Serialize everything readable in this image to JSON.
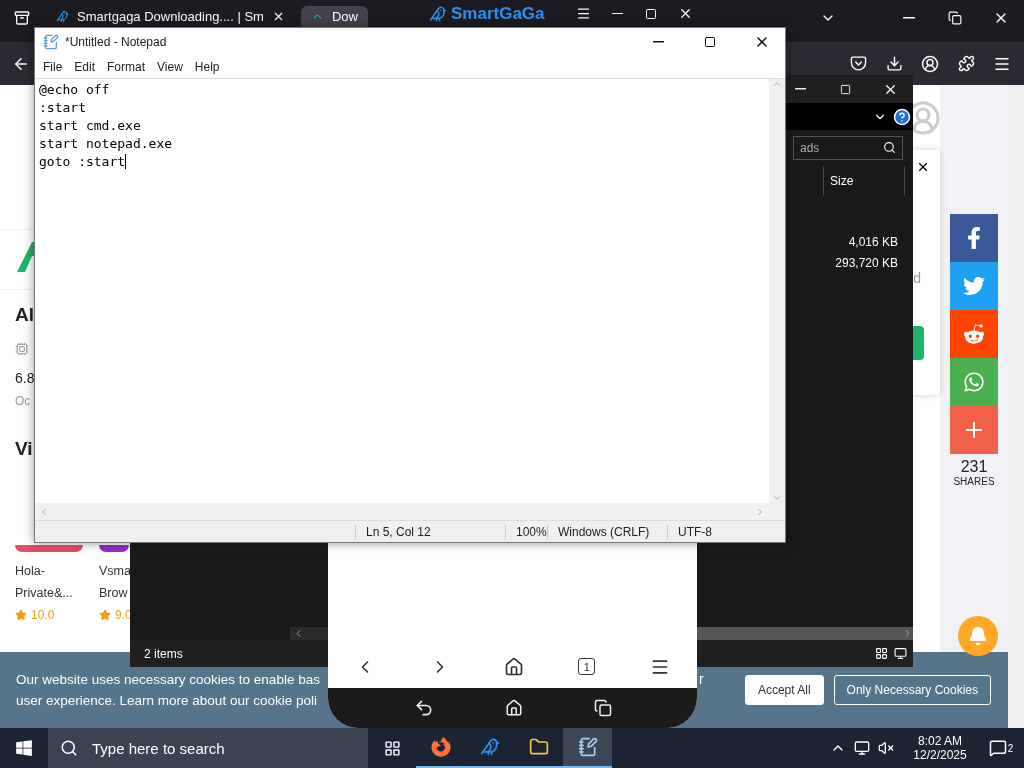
{
  "browser": {
    "tabs": [
      {
        "label": "Smartgaga Downloading.... | Sm",
        "selected": false
      },
      {
        "label": "Dow",
        "selected": true
      }
    ]
  },
  "emulator_window": {
    "title": "SmartGaGa",
    "tab_count": "1"
  },
  "page": {
    "heading": "Al",
    "spec_value": "6.8",
    "date": "Oc",
    "section": "Vi",
    "apps": [
      {
        "name": [
          "Hola-",
          "Private&..."
        ],
        "rating": "10.0",
        "color": "#e0506a"
      },
      {
        "name": [
          "Vsma",
          "Brow"
        ],
        "rating": "9.0",
        "color": "#9b2bc9"
      }
    ],
    "popup_fragment": "d",
    "share_buttons": [
      {
        "kind": "facebook",
        "color": "#3b5998"
      },
      {
        "kind": "twitter",
        "color": "#1da1f2"
      },
      {
        "kind": "reddit",
        "color": "#ff4500"
      },
      {
        "kind": "whatsapp",
        "color": "#4caf50"
      },
      {
        "kind": "more",
        "color": "#f2614a"
      }
    ],
    "share_count": "231",
    "share_label": "SHARES"
  },
  "cookie_banner": {
    "lines": [
      "Our website uses necessary cookies to enable bas",
      "user experience. Learn more about our cookie poli"
    ],
    "tail": "r",
    "buttons": [
      "Accept All",
      "Only Necessary Cookies"
    ]
  },
  "explorer": {
    "search": "ads",
    "column": "Size",
    "rows": [
      "4,016 KB",
      "293,720 KB"
    ],
    "status": "2 items"
  },
  "notepad": {
    "title": "*Untitled - Notepad",
    "menu": [
      "File",
      "Edit",
      "Format",
      "View",
      "Help"
    ],
    "lines": [
      "@echo off",
      ":start",
      "start cmd.exe",
      "start notepad.exe",
      "goto :start"
    ],
    "status": [
      "Ln 5, Col 12",
      "100%",
      "Windows (CRLF)",
      "UTF-8"
    ]
  },
  "taskbar": {
    "search_placeholder": "Type here to search",
    "apps": [
      {
        "kind": "firefox",
        "selected": false
      },
      {
        "kind": "swan",
        "selected": false
      },
      {
        "kind": "folder",
        "selected": false
      },
      {
        "kind": "notepad",
        "selected": true
      }
    ],
    "time": "8:02 AM",
    "date": "12/2/2025",
    "notifications": "2"
  }
}
